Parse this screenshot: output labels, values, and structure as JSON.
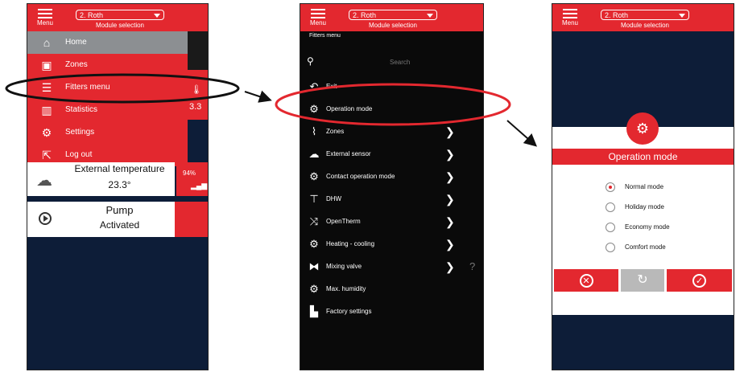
{
  "header": {
    "menu_label": "Menu",
    "module_value": "2. Roth",
    "module_label": "Module selection"
  },
  "panel1": {
    "menu": [
      {
        "label": "Home",
        "icon": "home-icon"
      },
      {
        "label": "Zones",
        "icon": "zones-icon"
      },
      {
        "label": "Fitters menu",
        "icon": "fitter-icon"
      },
      {
        "label": "Statistics",
        "icon": "statistics-icon"
      },
      {
        "label": "Settings",
        "icon": "sliders-icon"
      },
      {
        "label": "Log out",
        "icon": "logout-icon"
      }
    ],
    "temp": {
      "title": "External temperature",
      "value": "23.3°",
      "badge_pct": "94%",
      "peek_val": "3.3"
    },
    "pump": {
      "title": "Pump",
      "value": "Activated"
    }
  },
  "panel2": {
    "crumb": "Fitters menu",
    "search_placeholder": "Search",
    "items": [
      {
        "label": "Exit",
        "icon": "back-arrow-icon",
        "chevron": false
      },
      {
        "label": "Operation mode",
        "icon": "gears-icon",
        "chevron": false
      },
      {
        "label": "Zones",
        "icon": "chart-icon",
        "chevron": true
      },
      {
        "label": "External sensor",
        "icon": "sensor-icon",
        "chevron": true
      },
      {
        "label": "Contact operation mode",
        "icon": "gears-icon",
        "chevron": true
      },
      {
        "label": "DHW",
        "icon": "tap-icon",
        "chevron": true
      },
      {
        "label": "OpenTherm",
        "icon": "shuffle-icon",
        "chevron": true
      },
      {
        "label": "Heating - cooling",
        "icon": "gears-icon",
        "chevron": true
      },
      {
        "label": "Mixing valve",
        "icon": "valve-icon",
        "chevron": true,
        "help": "?"
      },
      {
        "label": "Max. humidity",
        "icon": "gears-icon",
        "chevron": false
      },
      {
        "label": "Factory settings",
        "icon": "factory-icon",
        "chevron": false
      }
    ]
  },
  "panel3": {
    "title": "Operation mode",
    "options": [
      {
        "label": "Normal mode",
        "selected": true
      },
      {
        "label": "Holiday mode",
        "selected": false
      },
      {
        "label": "Economy mode",
        "selected": false
      },
      {
        "label": "Comfort mode",
        "selected": false
      }
    ]
  },
  "colors": {
    "accent": "#e3282f",
    "navy": "#0d1d38",
    "grey": "#8c8f92"
  }
}
